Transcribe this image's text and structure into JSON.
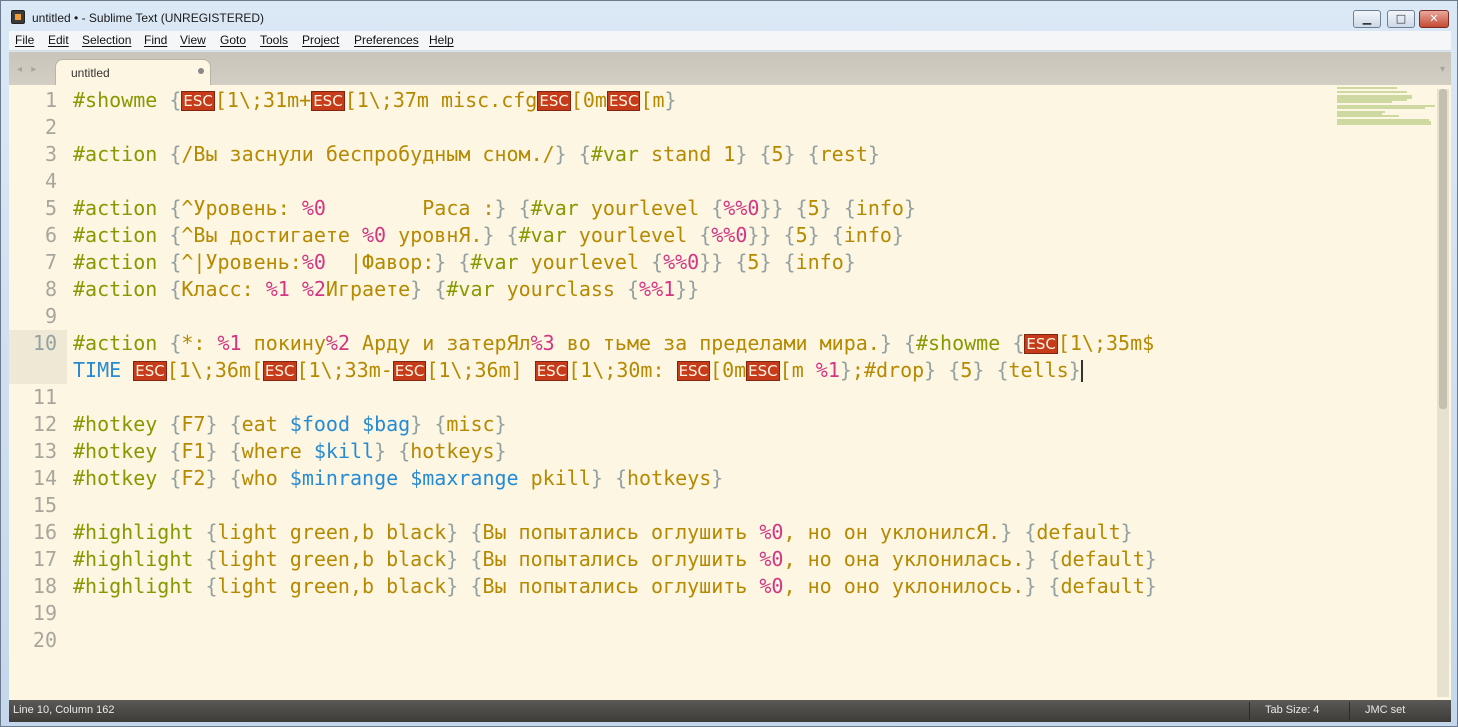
{
  "window": {
    "title": "untitled • - Sublime Text (UNREGISTERED)",
    "minimize_label": "▁",
    "maximize_label": "□",
    "close_label": "✕"
  },
  "menu": [
    "File",
    "Edit",
    "Selection",
    "Find",
    "View",
    "Goto",
    "Tools",
    "Project",
    "Preferences",
    "Help"
  ],
  "tabs": [
    {
      "label": "untitled",
      "modified": true
    }
  ],
  "tab_nav": "◂ ▸",
  "tab_scroll": "▾",
  "line_numbers": [
    "1",
    "2",
    "3",
    "4",
    "5",
    "6",
    "7",
    "8",
    "9",
    "10",
    "",
    "11",
    "12",
    "13",
    "14",
    "15",
    "16",
    "17",
    "18",
    "19",
    "20"
  ],
  "status": {
    "position": "Line 10, Column 162",
    "tab_size": "Tab Size: 4",
    "syntax": "JMC set"
  },
  "colors": {
    "background": "#fdf6e3",
    "keyword": "#859900",
    "string": "#b58900",
    "argument": "#d33682",
    "variable": "#268bd2",
    "escape_bg": "#c63b1a"
  },
  "code": [
    [
      [
        "kw",
        "#showme"
      ],
      [
        "plain",
        " "
      ],
      [
        "br",
        "{"
      ],
      [
        "esc",
        "ESC"
      ],
      [
        "str",
        "[1\\;31m+"
      ],
      [
        "esc",
        "ESC"
      ],
      [
        "str",
        "[1\\;37m misc.cfg"
      ],
      [
        "esc",
        "ESC"
      ],
      [
        "str",
        "[0m"
      ],
      [
        "esc",
        "ESC"
      ],
      [
        "str",
        "[m"
      ],
      [
        "br",
        "}"
      ]
    ],
    [],
    [
      [
        "kw",
        "#action"
      ],
      [
        "plain",
        " "
      ],
      [
        "br",
        "{"
      ],
      [
        "str",
        "/Вы заснули беспробудным сном./"
      ],
      [
        "br",
        "}"
      ],
      [
        "plain",
        " "
      ],
      [
        "br",
        "{"
      ],
      [
        "kw",
        "#var"
      ],
      [
        "str",
        " stand 1"
      ],
      [
        "br",
        "}"
      ],
      [
        "plain",
        " "
      ],
      [
        "br",
        "{"
      ],
      [
        "str",
        "5"
      ],
      [
        "br",
        "}"
      ],
      [
        "plain",
        " "
      ],
      [
        "br",
        "{"
      ],
      [
        "str",
        "rest"
      ],
      [
        "br",
        "}"
      ]
    ],
    [],
    [
      [
        "kw",
        "#action"
      ],
      [
        "plain",
        " "
      ],
      [
        "br",
        "{"
      ],
      [
        "str",
        "^Уровень: "
      ],
      [
        "arg",
        "%0"
      ],
      [
        "str",
        "        Раса :"
      ],
      [
        "br",
        "}"
      ],
      [
        "plain",
        " "
      ],
      [
        "br",
        "{"
      ],
      [
        "kw",
        "#var"
      ],
      [
        "str",
        " yourlevel "
      ],
      [
        "br",
        "{"
      ],
      [
        "arg",
        "%%0"
      ],
      [
        "br",
        "}}"
      ],
      [
        "plain",
        " "
      ],
      [
        "br",
        "{"
      ],
      [
        "str",
        "5"
      ],
      [
        "br",
        "}"
      ],
      [
        "plain",
        " "
      ],
      [
        "br",
        "{"
      ],
      [
        "str",
        "info"
      ],
      [
        "br",
        "}"
      ]
    ],
    [
      [
        "kw",
        "#action"
      ],
      [
        "plain",
        " "
      ],
      [
        "br",
        "{"
      ],
      [
        "str",
        "^Вы достигаете "
      ],
      [
        "arg",
        "%0"
      ],
      [
        "str",
        " уровнЯ."
      ],
      [
        "br",
        "}"
      ],
      [
        "plain",
        " "
      ],
      [
        "br",
        "{"
      ],
      [
        "kw",
        "#var"
      ],
      [
        "str",
        " yourlevel "
      ],
      [
        "br",
        "{"
      ],
      [
        "arg",
        "%%0"
      ],
      [
        "br",
        "}}"
      ],
      [
        "plain",
        " "
      ],
      [
        "br",
        "{"
      ],
      [
        "str",
        "5"
      ],
      [
        "br",
        "}"
      ],
      [
        "plain",
        " "
      ],
      [
        "br",
        "{"
      ],
      [
        "str",
        "info"
      ],
      [
        "br",
        "}"
      ]
    ],
    [
      [
        "kw",
        "#action"
      ],
      [
        "plain",
        " "
      ],
      [
        "br",
        "{"
      ],
      [
        "str",
        "^|Уровень:"
      ],
      [
        "arg",
        "%0"
      ],
      [
        "str",
        "  |Фавор:"
      ],
      [
        "br",
        "}"
      ],
      [
        "plain",
        " "
      ],
      [
        "br",
        "{"
      ],
      [
        "kw",
        "#var"
      ],
      [
        "str",
        " yourlevel "
      ],
      [
        "br",
        "{"
      ],
      [
        "arg",
        "%%0"
      ],
      [
        "br",
        "}}"
      ],
      [
        "plain",
        " "
      ],
      [
        "br",
        "{"
      ],
      [
        "str",
        "5"
      ],
      [
        "br",
        "}"
      ],
      [
        "plain",
        " "
      ],
      [
        "br",
        "{"
      ],
      [
        "str",
        "info"
      ],
      [
        "br",
        "}"
      ]
    ],
    [
      [
        "kw",
        "#action"
      ],
      [
        "plain",
        " "
      ],
      [
        "br",
        "{"
      ],
      [
        "str",
        "Класс: "
      ],
      [
        "arg",
        "%1"
      ],
      [
        "str",
        " "
      ],
      [
        "arg",
        "%2"
      ],
      [
        "str",
        "Играете"
      ],
      [
        "br",
        "}"
      ],
      [
        "plain",
        " "
      ],
      [
        "br",
        "{"
      ],
      [
        "kw",
        "#var"
      ],
      [
        "str",
        " yourclass "
      ],
      [
        "br",
        "{"
      ],
      [
        "arg",
        "%%1"
      ],
      [
        "br",
        "}}"
      ]
    ],
    [],
    [
      [
        "kw",
        "#action"
      ],
      [
        "plain",
        " "
      ],
      [
        "br",
        "{"
      ],
      [
        "str",
        "*: "
      ],
      [
        "arg",
        "%1"
      ],
      [
        "str",
        " покину"
      ],
      [
        "arg",
        "%2"
      ],
      [
        "str",
        " Арду и затерЯл"
      ],
      [
        "arg",
        "%3"
      ],
      [
        "str",
        " во тьме за пределами мира."
      ],
      [
        "br",
        "}"
      ],
      [
        "plain",
        " "
      ],
      [
        "br",
        "{"
      ],
      [
        "kw",
        "#showme"
      ],
      [
        "plain",
        " "
      ],
      [
        "br",
        "{"
      ],
      [
        "esc",
        "ESC"
      ],
      [
        "str",
        "[1\\;35m$"
      ]
    ],
    [
      [
        "var",
        "TIME"
      ],
      [
        "plain",
        " "
      ],
      [
        "esc",
        "ESC"
      ],
      [
        "str",
        "[1\\;36m["
      ],
      [
        "esc",
        "ESC"
      ],
      [
        "str",
        "[1\\;33m-"
      ],
      [
        "esc",
        "ESC"
      ],
      [
        "str",
        "[1\\;36m] "
      ],
      [
        "esc",
        "ESC"
      ],
      [
        "str",
        "[1\\;30m: "
      ],
      [
        "esc",
        "ESC"
      ],
      [
        "str",
        "[0m"
      ],
      [
        "esc",
        "ESC"
      ],
      [
        "str",
        "[m "
      ],
      [
        "arg",
        "%1"
      ],
      [
        "br",
        "}"
      ],
      [
        "str",
        ";#drop"
      ],
      [
        "br",
        "}"
      ],
      [
        "plain",
        " "
      ],
      [
        "br",
        "{"
      ],
      [
        "str",
        "5"
      ],
      [
        "br",
        "}"
      ],
      [
        "plain",
        " "
      ],
      [
        "br",
        "{"
      ],
      [
        "str",
        "tells"
      ],
      [
        "br",
        "}"
      ]
    ],
    [],
    [
      [
        "kw",
        "#hotkey"
      ],
      [
        "plain",
        " "
      ],
      [
        "br",
        "{"
      ],
      [
        "str",
        "F7"
      ],
      [
        "br",
        "}"
      ],
      [
        "plain",
        " "
      ],
      [
        "br",
        "{"
      ],
      [
        "str",
        "eat "
      ],
      [
        "var",
        "$food"
      ],
      [
        "str",
        " "
      ],
      [
        "var",
        "$bag"
      ],
      [
        "br",
        "}"
      ],
      [
        "plain",
        " "
      ],
      [
        "br",
        "{"
      ],
      [
        "str",
        "misc"
      ],
      [
        "br",
        "}"
      ]
    ],
    [
      [
        "kw",
        "#hotkey"
      ],
      [
        "plain",
        " "
      ],
      [
        "br",
        "{"
      ],
      [
        "str",
        "F1"
      ],
      [
        "br",
        "}"
      ],
      [
        "plain",
        " "
      ],
      [
        "br",
        "{"
      ],
      [
        "str",
        "where "
      ],
      [
        "var",
        "$kill"
      ],
      [
        "br",
        "}"
      ],
      [
        "plain",
        " "
      ],
      [
        "br",
        "{"
      ],
      [
        "str",
        "hotkeys"
      ],
      [
        "br",
        "}"
      ]
    ],
    [
      [
        "kw",
        "#hotkey"
      ],
      [
        "plain",
        " "
      ],
      [
        "br",
        "{"
      ],
      [
        "str",
        "F2"
      ],
      [
        "br",
        "}"
      ],
      [
        "plain",
        " "
      ],
      [
        "br",
        "{"
      ],
      [
        "str",
        "who "
      ],
      [
        "var",
        "$minrange"
      ],
      [
        "str",
        " "
      ],
      [
        "var",
        "$maxrange"
      ],
      [
        "str",
        " pkill"
      ],
      [
        "br",
        "}"
      ],
      [
        "plain",
        " "
      ],
      [
        "br",
        "{"
      ],
      [
        "str",
        "hotkeys"
      ],
      [
        "br",
        "}"
      ]
    ],
    [],
    [
      [
        "kw",
        "#highlight"
      ],
      [
        "plain",
        " "
      ],
      [
        "br",
        "{"
      ],
      [
        "str",
        "light green,b black"
      ],
      [
        "br",
        "}"
      ],
      [
        "plain",
        " "
      ],
      [
        "br",
        "{"
      ],
      [
        "str",
        "Вы попытались оглушить "
      ],
      [
        "arg",
        "%0"
      ],
      [
        "str",
        ", но он уклонилсЯ."
      ],
      [
        "br",
        "}"
      ],
      [
        "plain",
        " "
      ],
      [
        "br",
        "{"
      ],
      [
        "str",
        "default"
      ],
      [
        "br",
        "}"
      ]
    ],
    [
      [
        "kw",
        "#highlight"
      ],
      [
        "plain",
        " "
      ],
      [
        "br",
        "{"
      ],
      [
        "str",
        "light green,b black"
      ],
      [
        "br",
        "}"
      ],
      [
        "plain",
        " "
      ],
      [
        "br",
        "{"
      ],
      [
        "str",
        "Вы попытались оглушить "
      ],
      [
        "arg",
        "%0"
      ],
      [
        "str",
        ", но она уклонилась."
      ],
      [
        "br",
        "}"
      ],
      [
        "plain",
        " "
      ],
      [
        "br",
        "{"
      ],
      [
        "str",
        "default"
      ],
      [
        "br",
        "}"
      ]
    ],
    [
      [
        "kw",
        "#highlight"
      ],
      [
        "plain",
        " "
      ],
      [
        "br",
        "{"
      ],
      [
        "str",
        "light green,b black"
      ],
      [
        "br",
        "}"
      ],
      [
        "plain",
        " "
      ],
      [
        "br",
        "{"
      ],
      [
        "str",
        "Вы попытались оглушить "
      ],
      [
        "arg",
        "%0"
      ],
      [
        "str",
        ", но оно уклонилось."
      ],
      [
        "br",
        "}"
      ],
      [
        "plain",
        " "
      ],
      [
        "br",
        "{"
      ],
      [
        "str",
        "default"
      ],
      [
        "br",
        "}"
      ]
    ],
    [],
    []
  ]
}
